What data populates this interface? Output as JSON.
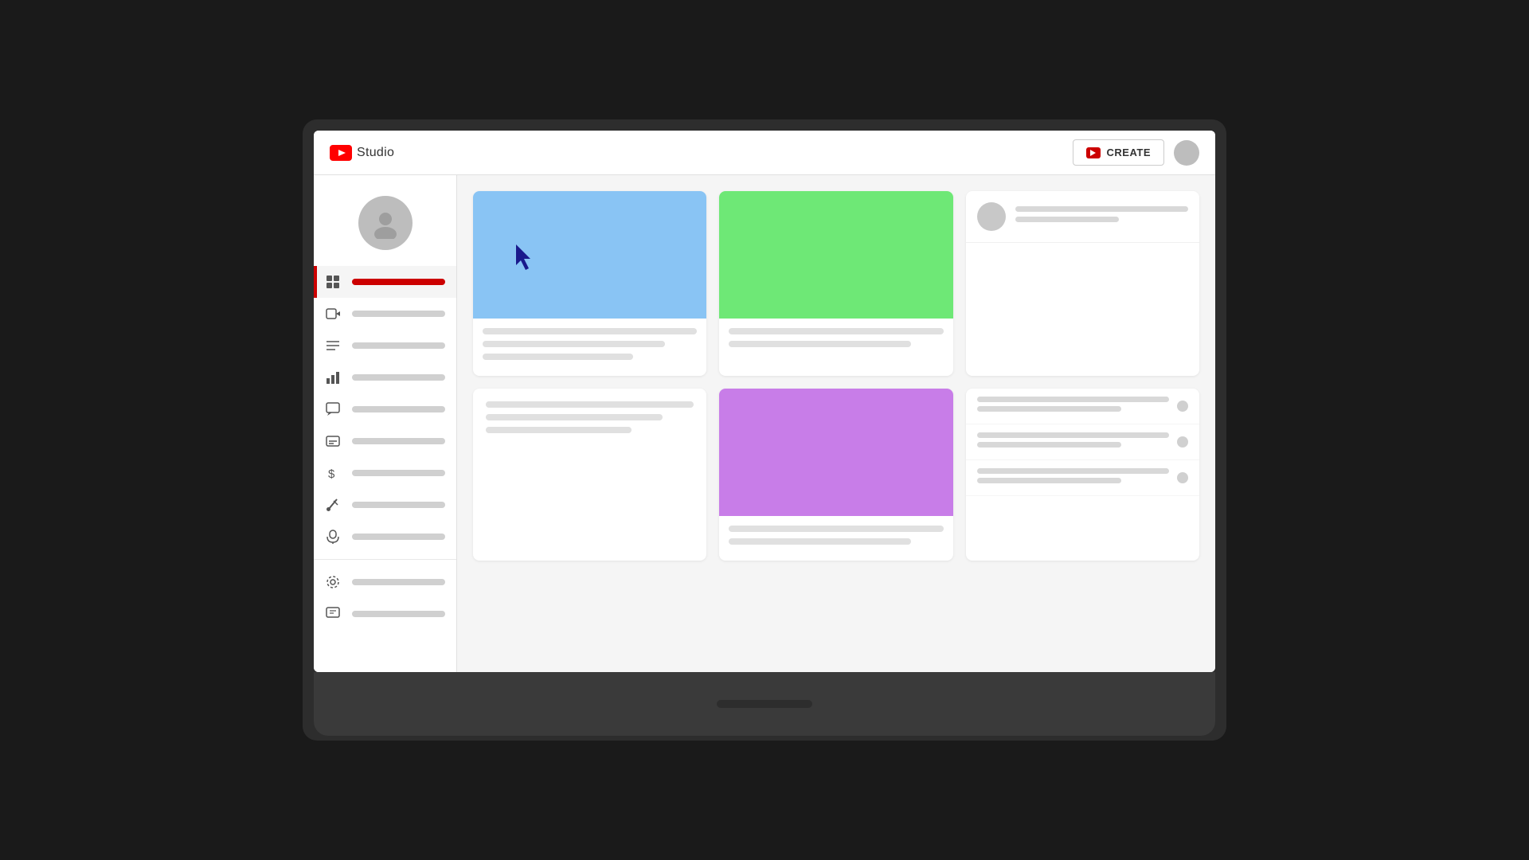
{
  "header": {
    "logo_text": "Studio",
    "create_label": "CREATE"
  },
  "sidebar": {
    "items": [
      {
        "id": "dashboard",
        "icon": "grid-icon",
        "active": true
      },
      {
        "id": "content",
        "icon": "video-icon",
        "active": false
      },
      {
        "id": "playlists",
        "icon": "list-icon",
        "active": false
      },
      {
        "id": "analytics",
        "icon": "bar-chart-icon",
        "active": false
      },
      {
        "id": "comments",
        "icon": "comment-icon",
        "active": false
      },
      {
        "id": "subtitles",
        "icon": "subtitle-icon",
        "active": false
      },
      {
        "id": "monetization",
        "icon": "dollar-icon",
        "active": false
      },
      {
        "id": "customization",
        "icon": "brush-icon",
        "active": false
      },
      {
        "id": "audio",
        "icon": "audio-icon",
        "active": false
      }
    ],
    "bottom_items": [
      {
        "id": "settings",
        "icon": "gear-icon"
      },
      {
        "id": "feedback",
        "icon": "feedback-icon"
      }
    ]
  },
  "cards": [
    {
      "id": "card1",
      "thumb_color": "blue",
      "has_cursor": true,
      "lines": [
        "long",
        "medium",
        "short"
      ]
    },
    {
      "id": "card2",
      "thumb_color": "green",
      "lines": [
        "long",
        "medium"
      ]
    },
    {
      "id": "card3",
      "type": "profile",
      "has_avatar": true
    },
    {
      "id": "card4",
      "type": "text-only",
      "lines": [
        "long",
        "medium",
        "short"
      ]
    },
    {
      "id": "card5",
      "thumb_color": "purple",
      "lines": [
        "long",
        "medium"
      ]
    },
    {
      "id": "card6",
      "type": "list",
      "rows": 3
    }
  ],
  "colors": {
    "accent": "#cc0000",
    "sidebar_active": "#cc0000",
    "thumb_blue": "#89c4f4",
    "thumb_green": "#6ee876",
    "thumb_purple": "#c87de8",
    "cursor": "#1a1a8c"
  }
}
